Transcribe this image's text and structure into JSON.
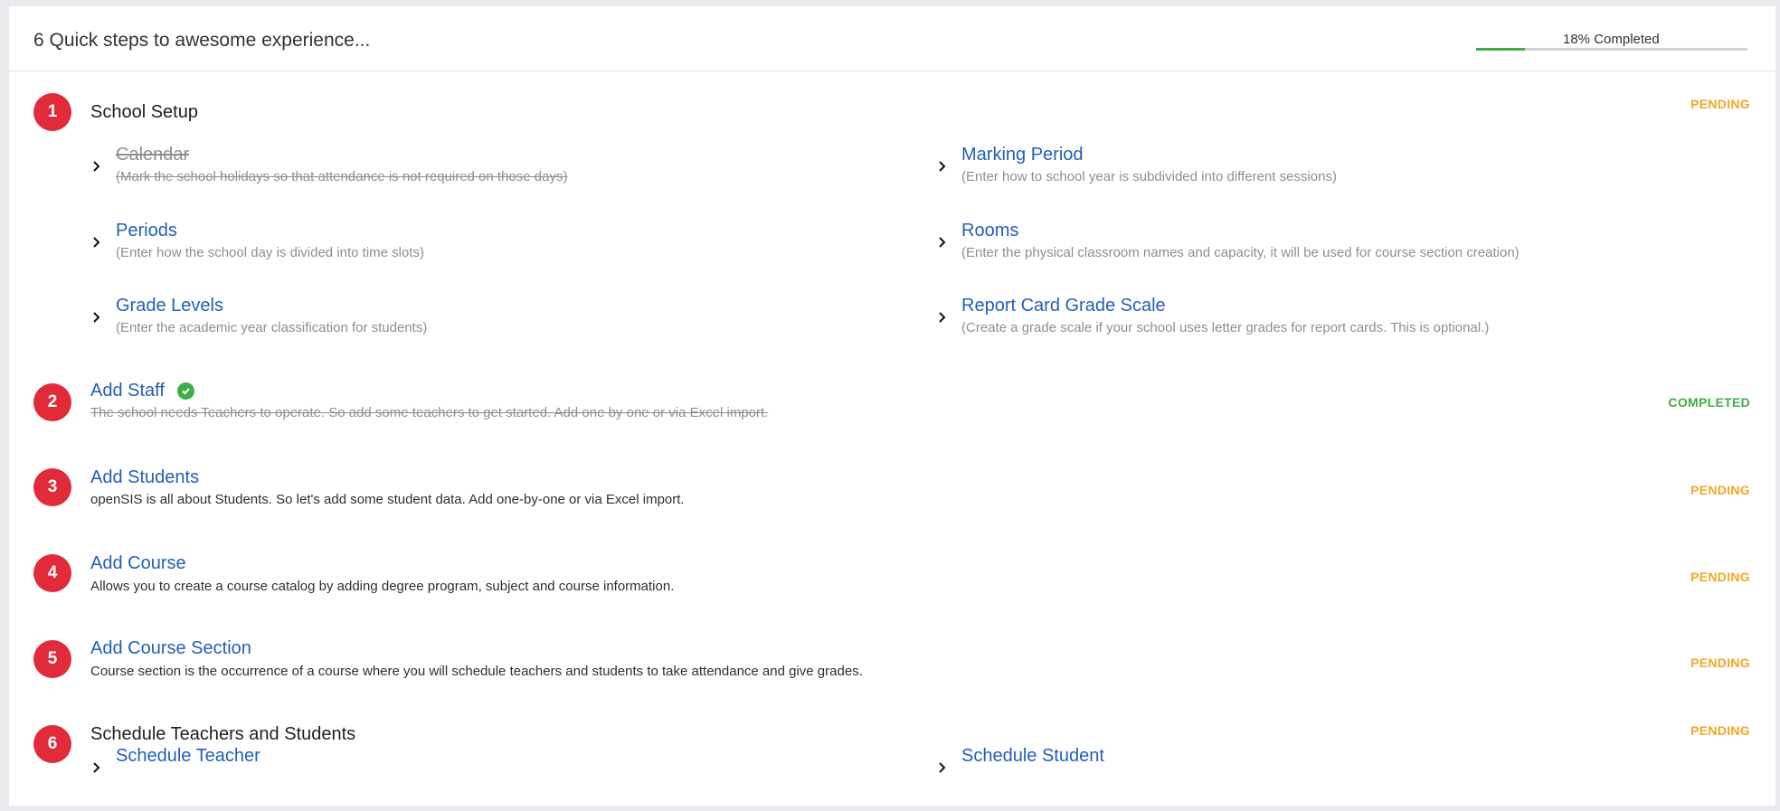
{
  "header": {
    "title": "6 Quick steps to awesome experience...",
    "progress_label": "18% Completed",
    "progress_fraction": 0.18
  },
  "colors": {
    "step_badge": "#e22b3a",
    "link": "#235fb8",
    "pending": "#f5a623",
    "completed": "#3fae49"
  },
  "steps": [
    {
      "number": "1",
      "title": "School Setup",
      "status": "PENDING",
      "substeps": [
        {
          "label": "Calendar",
          "desc": "(Mark the school holidays so that attendance is not required on those days)"
        },
        {
          "label": "Marking Period",
          "desc": "(Enter how to school year is subdivided into different sessions)"
        },
        {
          "label": "Periods",
          "desc": "(Enter how the school day is divided into time slots)"
        },
        {
          "label": "Rooms",
          "desc": "(Enter the physical classroom names and capacity, it will be used for course section creation)"
        },
        {
          "label": "Grade Levels",
          "desc": "(Enter the academic year classification for students)"
        },
        {
          "label": "Report Card Grade Scale",
          "desc": "(Create a grade scale if your school uses letter grades for report cards. This is optional.)"
        }
      ]
    },
    {
      "number": "2",
      "title": "Add Staff",
      "desc": "The school needs Teachers to operate. So add some teachers to get started. Add one by one or via Excel import.",
      "status": "COMPLETED"
    },
    {
      "number": "3",
      "title": "Add Students",
      "desc": "openSIS is all about Students. So let's add some student data. Add one-by-one or via Excel import.",
      "status": "PENDING"
    },
    {
      "number": "4",
      "title": "Add Course",
      "desc": "Allows you to create a course catalog by adding degree program, subject and course information.",
      "status": "PENDING"
    },
    {
      "number": "5",
      "title": "Add Course Section",
      "desc": "Course section is the occurrence of a course where you will schedule teachers and students to take attendance and give grades.",
      "status": "PENDING"
    },
    {
      "number": "6",
      "title": "Schedule Teachers and Students",
      "status": "PENDING",
      "substeps": [
        {
          "label": "Schedule Teacher"
        },
        {
          "label": "Schedule Student"
        }
      ]
    }
  ]
}
